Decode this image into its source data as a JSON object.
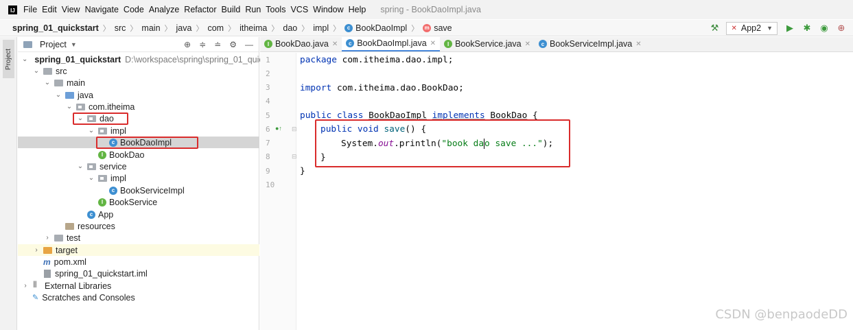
{
  "menubar": {
    "logo_text": "IJ",
    "items": [
      "File",
      "Edit",
      "View",
      "Navigate",
      "Code",
      "Analyze",
      "Refactor",
      "Build",
      "Run",
      "Tools",
      "VCS",
      "Window",
      "Help"
    ],
    "window_title": "spring - BookDaoImpl.java"
  },
  "breadcrumb": {
    "items": [
      "spring_01_quickstart",
      "src",
      "main",
      "java",
      "com",
      "itheima",
      "dao",
      "impl",
      "BookDaoImpl",
      "save"
    ]
  },
  "toolbar": {
    "run_config": "App2",
    "icons": [
      "hammer-icon",
      "run-icon",
      "debug-icon",
      "coverage-icon",
      "profile-icon"
    ]
  },
  "left_strip": {
    "tab_label": "Project"
  },
  "project_panel": {
    "title": "Project",
    "tree": {
      "root": "spring_01_quickstart",
      "root_path": "D:\\workspace\\spring\\spring_01_quic",
      "src": "src",
      "main": "main",
      "java": "java",
      "com_itheima": "com.itheima",
      "dao": "dao",
      "dao_impl": "impl",
      "book_dao_impl": "BookDaoImpl",
      "book_dao": "BookDao",
      "service": "service",
      "service_impl": "impl",
      "book_service_impl": "BookServiceImpl",
      "book_service": "BookService",
      "app": "App",
      "resources": "resources",
      "test": "test",
      "target": "target",
      "pom": "pom.xml",
      "iml": "spring_01_quickstart.iml",
      "external_libraries": "External Libraries",
      "scratches": "Scratches and Consoles"
    }
  },
  "editor": {
    "tabs": [
      {
        "label": "BookDao.java",
        "icon": "interface-icon",
        "active": false
      },
      {
        "label": "BookDaoImpl.java",
        "icon": "class-icon",
        "active": true
      },
      {
        "label": "BookService.java",
        "icon": "interface-icon",
        "active": false
      },
      {
        "label": "BookServiceImpl.java",
        "icon": "class-icon",
        "active": false
      }
    ],
    "line_numbers": [
      "1",
      "2",
      "3",
      "4",
      "5",
      "6",
      "7",
      "8",
      "9",
      "10"
    ],
    "code": {
      "l1_kw": "package",
      "l1_rest": " com.itheima.dao.impl;",
      "l3_kw": "import",
      "l3_rest": " com.itheima.dao.BookDao;",
      "l5_kw1": "public class",
      "l5_name": "BookDaoImpl",
      "l5_kw2": "implements",
      "l5_iface": "BookDao",
      "l5_brace": " {",
      "l6_kw": "public void",
      "l6_method": "save",
      "l6_rest": "() {",
      "l7_sys": "System.",
      "l7_out": "out",
      "l7_call": ".println(",
      "l7_str_a": "\"book da",
      "l7_str_b": "o save ...\"",
      "l7_end": ");",
      "l8": "}",
      "l9": "}"
    }
  },
  "watermark": "CSDN @benpaodeDD",
  "colors": {
    "highlight_box": "#d92b2b",
    "keyword": "#0033b3",
    "string": "#067d17",
    "method": "#00627a",
    "static_field": "#871094"
  }
}
